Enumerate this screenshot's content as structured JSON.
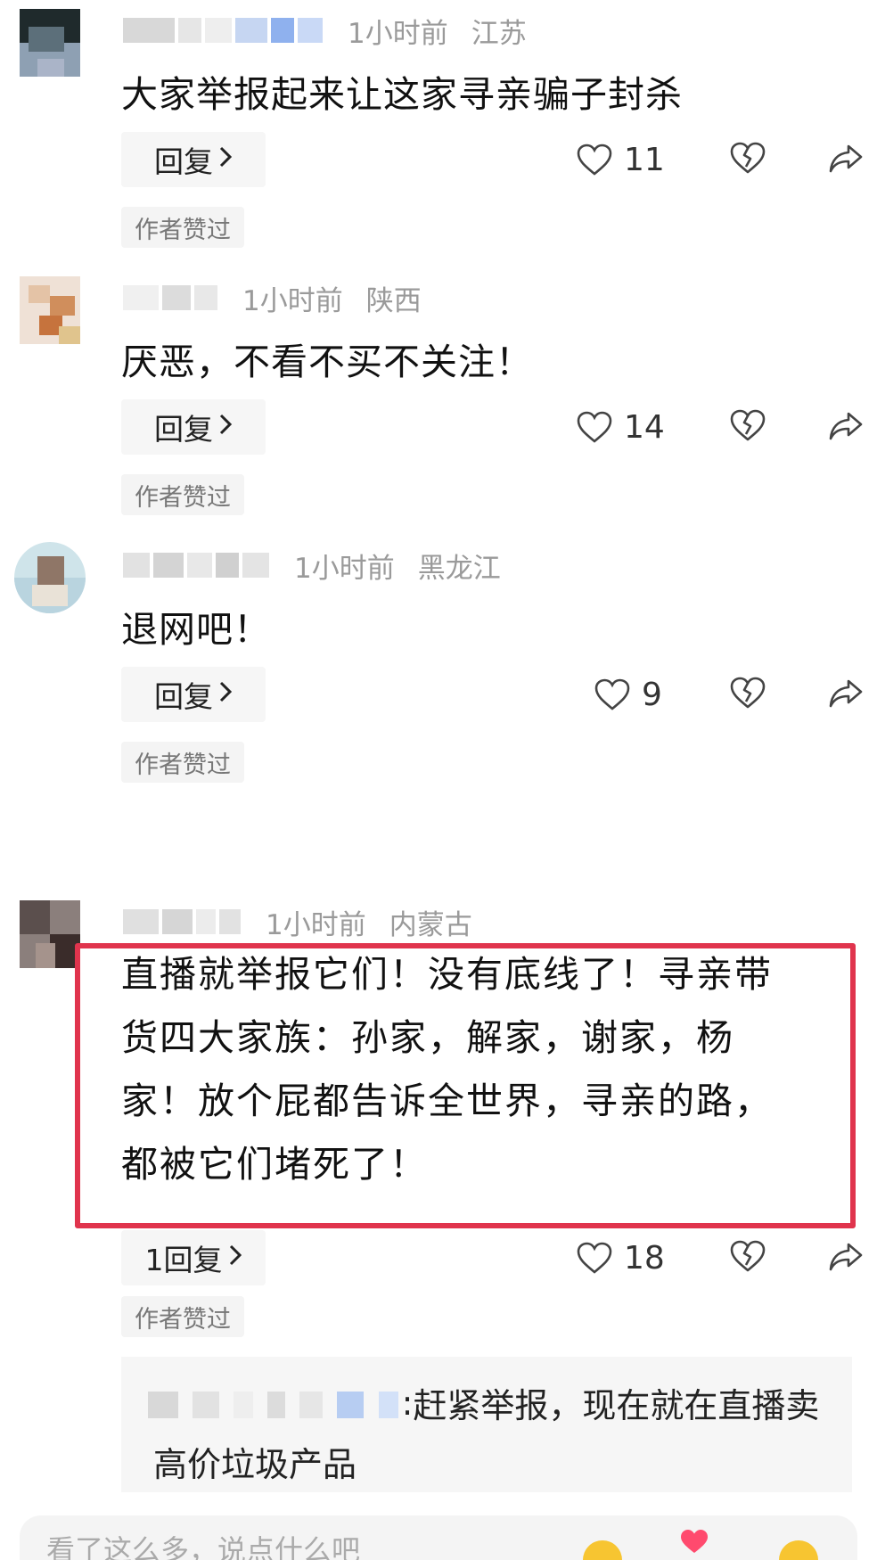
{
  "comments": [
    {
      "time": "1小时前",
      "location": "江苏",
      "text": "大家举报起来让这家寻亲骗子封杀",
      "reply_label": "回复",
      "likes": "11",
      "badge": "作者赞过"
    },
    {
      "time": "1小时前",
      "location": "陕西",
      "text": "厌恶，不看不买不关注！",
      "reply_label": "回复",
      "likes": "14",
      "badge": "作者赞过"
    },
    {
      "time": "1小时前",
      "location": "黑龙江",
      "text": "退网吧！",
      "reply_label": "回复",
      "likes": "9",
      "badge": "作者赞过"
    },
    {
      "time": "1小时前",
      "location": "内蒙古",
      "text_lines": [
        "直播就举报它们！没有底线了！寻亲带",
        "货四大家族：孙家，解家，谢家，杨",
        "家！放个屁都告诉全世界，寻亲的路，",
        "都被它们堵死了！"
      ],
      "reply_label": "1回复",
      "likes": "18",
      "badge": "作者赞过",
      "sub_reply": {
        "line1": "赶紧举报，现在就在直播卖",
        "line2": "高价垃圾产品"
      }
    }
  ],
  "input": {
    "placeholder": "看了这么多，说点什么吧"
  },
  "colors": {
    "highlight_border": "#e0344d",
    "meta_text": "#9a9a9a",
    "badge_bg": "#f4f4f4"
  },
  "icons": [
    "heart-icon",
    "heartbreak-icon",
    "share-arrow-icon",
    "chevron-right-icon"
  ]
}
